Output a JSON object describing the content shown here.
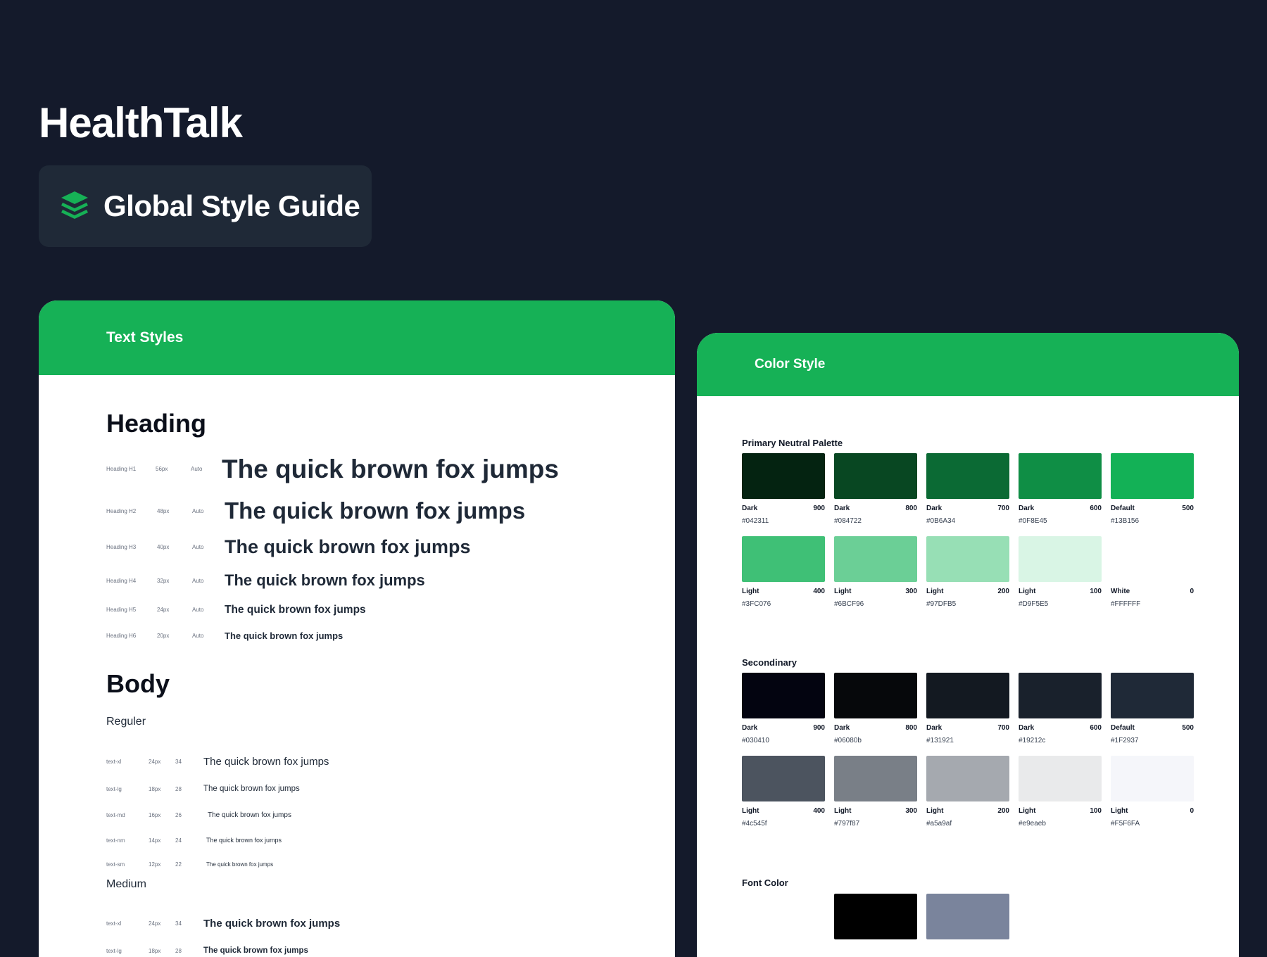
{
  "brand": {
    "title": "HealthTalk"
  },
  "badge": {
    "title": "Global Style Guide",
    "icon": "stack-layers-icon",
    "accent": "#16b156"
  },
  "text_styles": {
    "header": "Text Styles",
    "heading_title": "Heading",
    "headings": [
      {
        "name": "Heading H1",
        "size": "56px",
        "line": "Auto",
        "sample": "The quick brown fox jumps"
      },
      {
        "name": "Heading H2",
        "size": "48px",
        "line": "Auto",
        "sample": "The quick brown fox jumps"
      },
      {
        "name": "Heading H3",
        "size": "40px",
        "line": "Auto",
        "sample": "The quick brown fox jumps"
      },
      {
        "name": "Heading H4",
        "size": "32px",
        "line": "Auto",
        "sample": "The quick brown fox jumps"
      },
      {
        "name": "Heading H5",
        "size": "24px",
        "line": "Auto",
        "sample": "The quick brown fox jumps"
      },
      {
        "name": "Heading H6",
        "size": "20px",
        "line": "Auto",
        "sample": "The quick brown fox jumps"
      }
    ],
    "body_title": "Body",
    "regular_title": "Reguler",
    "regular": [
      {
        "name": "text-xl",
        "size": "24px",
        "line": "34",
        "sample": "The quick brown fox jumps"
      },
      {
        "name": "text-lg",
        "size": "18px",
        "line": "28",
        "sample": "The quick brown fox jumps"
      },
      {
        "name": "text-md",
        "size": "16px",
        "line": "26",
        "sample": "The quick brown fox jumps"
      },
      {
        "name": "text-nm",
        "size": "14px",
        "line": "24",
        "sample": "The quick brown fox jumps"
      },
      {
        "name": "text-sm",
        "size": "12px",
        "line": "22",
        "sample": "The quick brown fox jumps"
      }
    ],
    "medium_title": "Medium",
    "medium": [
      {
        "name": "text-xl",
        "size": "24px",
        "line": "34",
        "sample": "The quick brown fox jumps"
      },
      {
        "name": "text-lg",
        "size": "18px",
        "line": "28",
        "sample": "The quick brown fox jumps"
      }
    ]
  },
  "color_style": {
    "header": "Color Style",
    "primary_title": "Primary Neutral Palette",
    "primary": [
      {
        "label": "Dark",
        "weight": "900",
        "hex": "#042311",
        "color": "#042311"
      },
      {
        "label": "Dark",
        "weight": "800",
        "hex": "#084722",
        "color": "#084722"
      },
      {
        "label": "Dark",
        "weight": "700",
        "hex": "#0B6A34",
        "color": "#0B6A34"
      },
      {
        "label": "Dark",
        "weight": "600",
        "hex": "#0F8E45",
        "color": "#0F8E45"
      },
      {
        "label": "Default",
        "weight": "500",
        "hex": "#13B156",
        "color": "#13B156"
      },
      {
        "label": "Light",
        "weight": "400",
        "hex": "#3FC076",
        "color": "#3FC076"
      },
      {
        "label": "Light",
        "weight": "300",
        "hex": "#6BCF96",
        "color": "#6BCF96"
      },
      {
        "label": "Light",
        "weight": "200",
        "hex": "#97DFB5",
        "color": "#97DFB5"
      },
      {
        "label": "Light",
        "weight": "100",
        "hex": "#D9F5E5",
        "color": "#D9F5E5"
      },
      {
        "label": "White",
        "weight": "0",
        "hex": "#FFFFFF",
        "color": "#FFFFFF"
      }
    ],
    "secondary_title": "Secondinary",
    "secondary": [
      {
        "label": "Dark",
        "weight": "900",
        "hex": "#030410",
        "color": "#030410"
      },
      {
        "label": "Dark",
        "weight": "800",
        "hex": "#06080b",
        "color": "#06080b"
      },
      {
        "label": "Dark",
        "weight": "700",
        "hex": "#131921",
        "color": "#131921"
      },
      {
        "label": "Dark",
        "weight": "600",
        "hex": "#19212c",
        "color": "#19212c"
      },
      {
        "label": "Default",
        "weight": "500",
        "hex": "#1F2937",
        "color": "#1F2937"
      },
      {
        "label": "Light",
        "weight": "400",
        "hex": "#4c545f",
        "color": "#4c545f"
      },
      {
        "label": "Light",
        "weight": "300",
        "hex": "#797f87",
        "color": "#797f87"
      },
      {
        "label": "Light",
        "weight": "200",
        "hex": "#a5a9af",
        "color": "#a5a9af"
      },
      {
        "label": "Light",
        "weight": "100",
        "hex": "#e9eaeb",
        "color": "#e9eaeb"
      },
      {
        "label": "Light",
        "weight": "0",
        "hex": "#F5F6FA",
        "color": "#F5F6FA"
      }
    ],
    "font_title": "Font Color",
    "font_colors": [
      {
        "color": "#FFFFFF"
      },
      {
        "color": "#000000"
      },
      {
        "color": "#7a849c"
      }
    ]
  }
}
